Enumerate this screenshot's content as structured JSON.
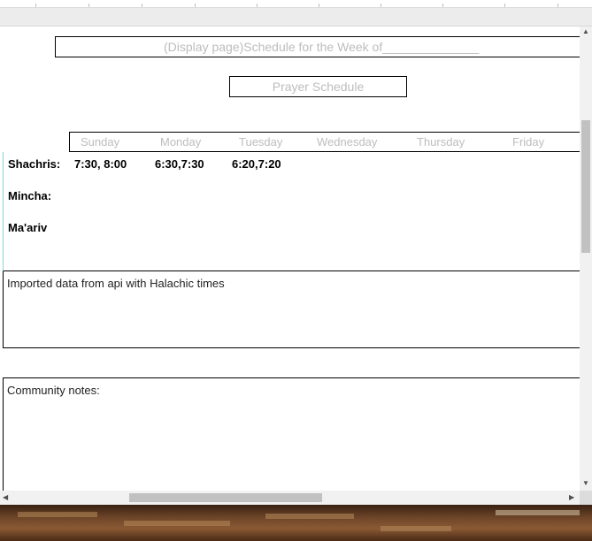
{
  "header": {
    "title": "(Display page)Schedule for the Week of______________",
    "subtitle": "Prayer Schedule"
  },
  "days": [
    "Sunday",
    "Monday",
    "Tuesday",
    "Wednesday",
    "Thursday",
    "Friday"
  ],
  "prayers": [
    {
      "label": "Shachris:",
      "times": [
        "7:30, 8:00",
        "6:30,7:30",
        "6:20,7:20"
      ]
    },
    {
      "label": "Mincha:",
      "times": []
    },
    {
      "label": "Ma'ariv",
      "times": []
    }
  ],
  "halachic": {
    "text": "Imported data from api with Halachic times"
  },
  "notes": {
    "label": "Community notes:"
  },
  "icons": {
    "scroll_up": "chevron-up-icon",
    "scroll_down": "chevron-down-icon",
    "scroll_left": "chevron-left-icon",
    "scroll_right": "chevron-right-icon"
  },
  "colors": {
    "placeholder_text": "#bdbdbd",
    "left_border_accent": "#7fd6d6",
    "scrollbar": "#c1c1c1"
  }
}
